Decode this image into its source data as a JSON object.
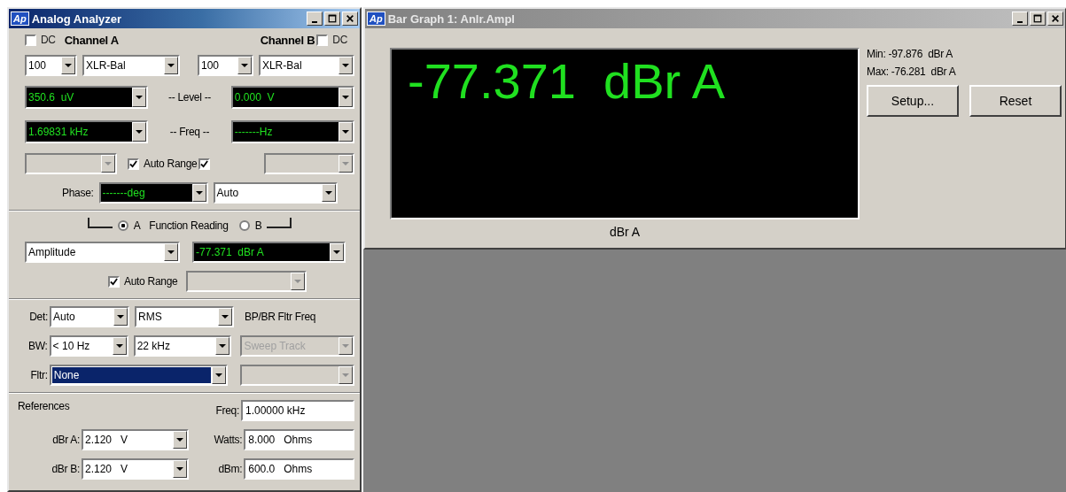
{
  "analyzer": {
    "logo": "Ap",
    "title": "Analog Analyzer",
    "channel_a": {
      "dc_label": "DC",
      "dc_checked": false,
      "label": "Channel A",
      "range": {
        "kind": "input",
        "value": "100"
      },
      "connector": {
        "kind": "input",
        "value": "XLR-Bal"
      },
      "level": {
        "kind": "display",
        "value": "350.6  uV"
      },
      "freq": {
        "kind": "display",
        "value": "1.69831 kHz"
      },
      "autorange_checked": true,
      "autorange_combo": {
        "kind": "disabled"
      }
    },
    "channel_b": {
      "dc_label": "DC",
      "dc_checked": false,
      "label": "Channel B",
      "range": {
        "kind": "input",
        "value": "100"
      },
      "connector": {
        "kind": "input",
        "value": "XLR-Bal"
      },
      "level": {
        "kind": "display",
        "value": "0.000  V"
      },
      "freq": {
        "kind": "display",
        "value": "-------Hz"
      },
      "autorange_checked": true,
      "autorange_combo": {
        "kind": "disabled"
      }
    },
    "level_label": "-- Level --",
    "freq_label": "-- Freq --",
    "autorange_label": "Auto Range",
    "phase": {
      "label": "Phase:",
      "reading": {
        "kind": "display",
        "value": "-------deg"
      },
      "mode": {
        "kind": "input",
        "value": "Auto"
      }
    },
    "function_reading": {
      "label": "Function Reading",
      "options": [
        {
          "label": "A",
          "selected": true
        },
        {
          "label": "B",
          "selected": false
        }
      ]
    },
    "function": {
      "kind": "input",
      "value": "Amplitude"
    },
    "reading": {
      "kind": "display",
      "value": "-77.371  dBr A"
    },
    "function_autorange": {
      "label": "Auto Range",
      "checked": true,
      "combo": {
        "kind": "disabled"
      }
    },
    "det": {
      "label": "Det:",
      "mode": {
        "kind": "input",
        "value": "Auto"
      },
      "type": {
        "kind": "input",
        "value": "RMS"
      },
      "note": "BP/BR Fltr Freq"
    },
    "bw": {
      "label": "BW:",
      "low": {
        "kind": "input",
        "value": "< 10 Hz"
      },
      "high": {
        "kind": "input",
        "value": "22 kHz"
      },
      "sweep": {
        "kind": "disabled",
        "value": "Sweep Track"
      }
    },
    "fltr": {
      "label": "Fltr:",
      "filter": {
        "kind": "highlighted",
        "value": "None"
      },
      "extra": {
        "kind": "disabled"
      }
    },
    "references": {
      "label": "References",
      "freq_label": "Freq:",
      "freq": "1.00000 kHz",
      "dbr_a_label": "dBr A:",
      "dbr_a": {
        "kind": "input",
        "value": "2.120   V"
      },
      "watts_label": "Watts:",
      "watts": "8.000   Ohms",
      "dbr_b_label": "dBr B:",
      "dbr_b": {
        "kind": "input",
        "value": "2.120   V"
      },
      "dbm_label": "dBm:",
      "dbm": "600.0   Ohms"
    }
  },
  "bar_graph": {
    "logo": "Ap",
    "title": "Bar Graph 1: Anlr.Ampl",
    "reading": "-77.371  dBr A",
    "unit": "dBr A",
    "min": "Min: -97.876  dBr A",
    "max": "Max: -76.281  dBr A",
    "buttons": [
      "Setup...",
      "Reset"
    ]
  }
}
